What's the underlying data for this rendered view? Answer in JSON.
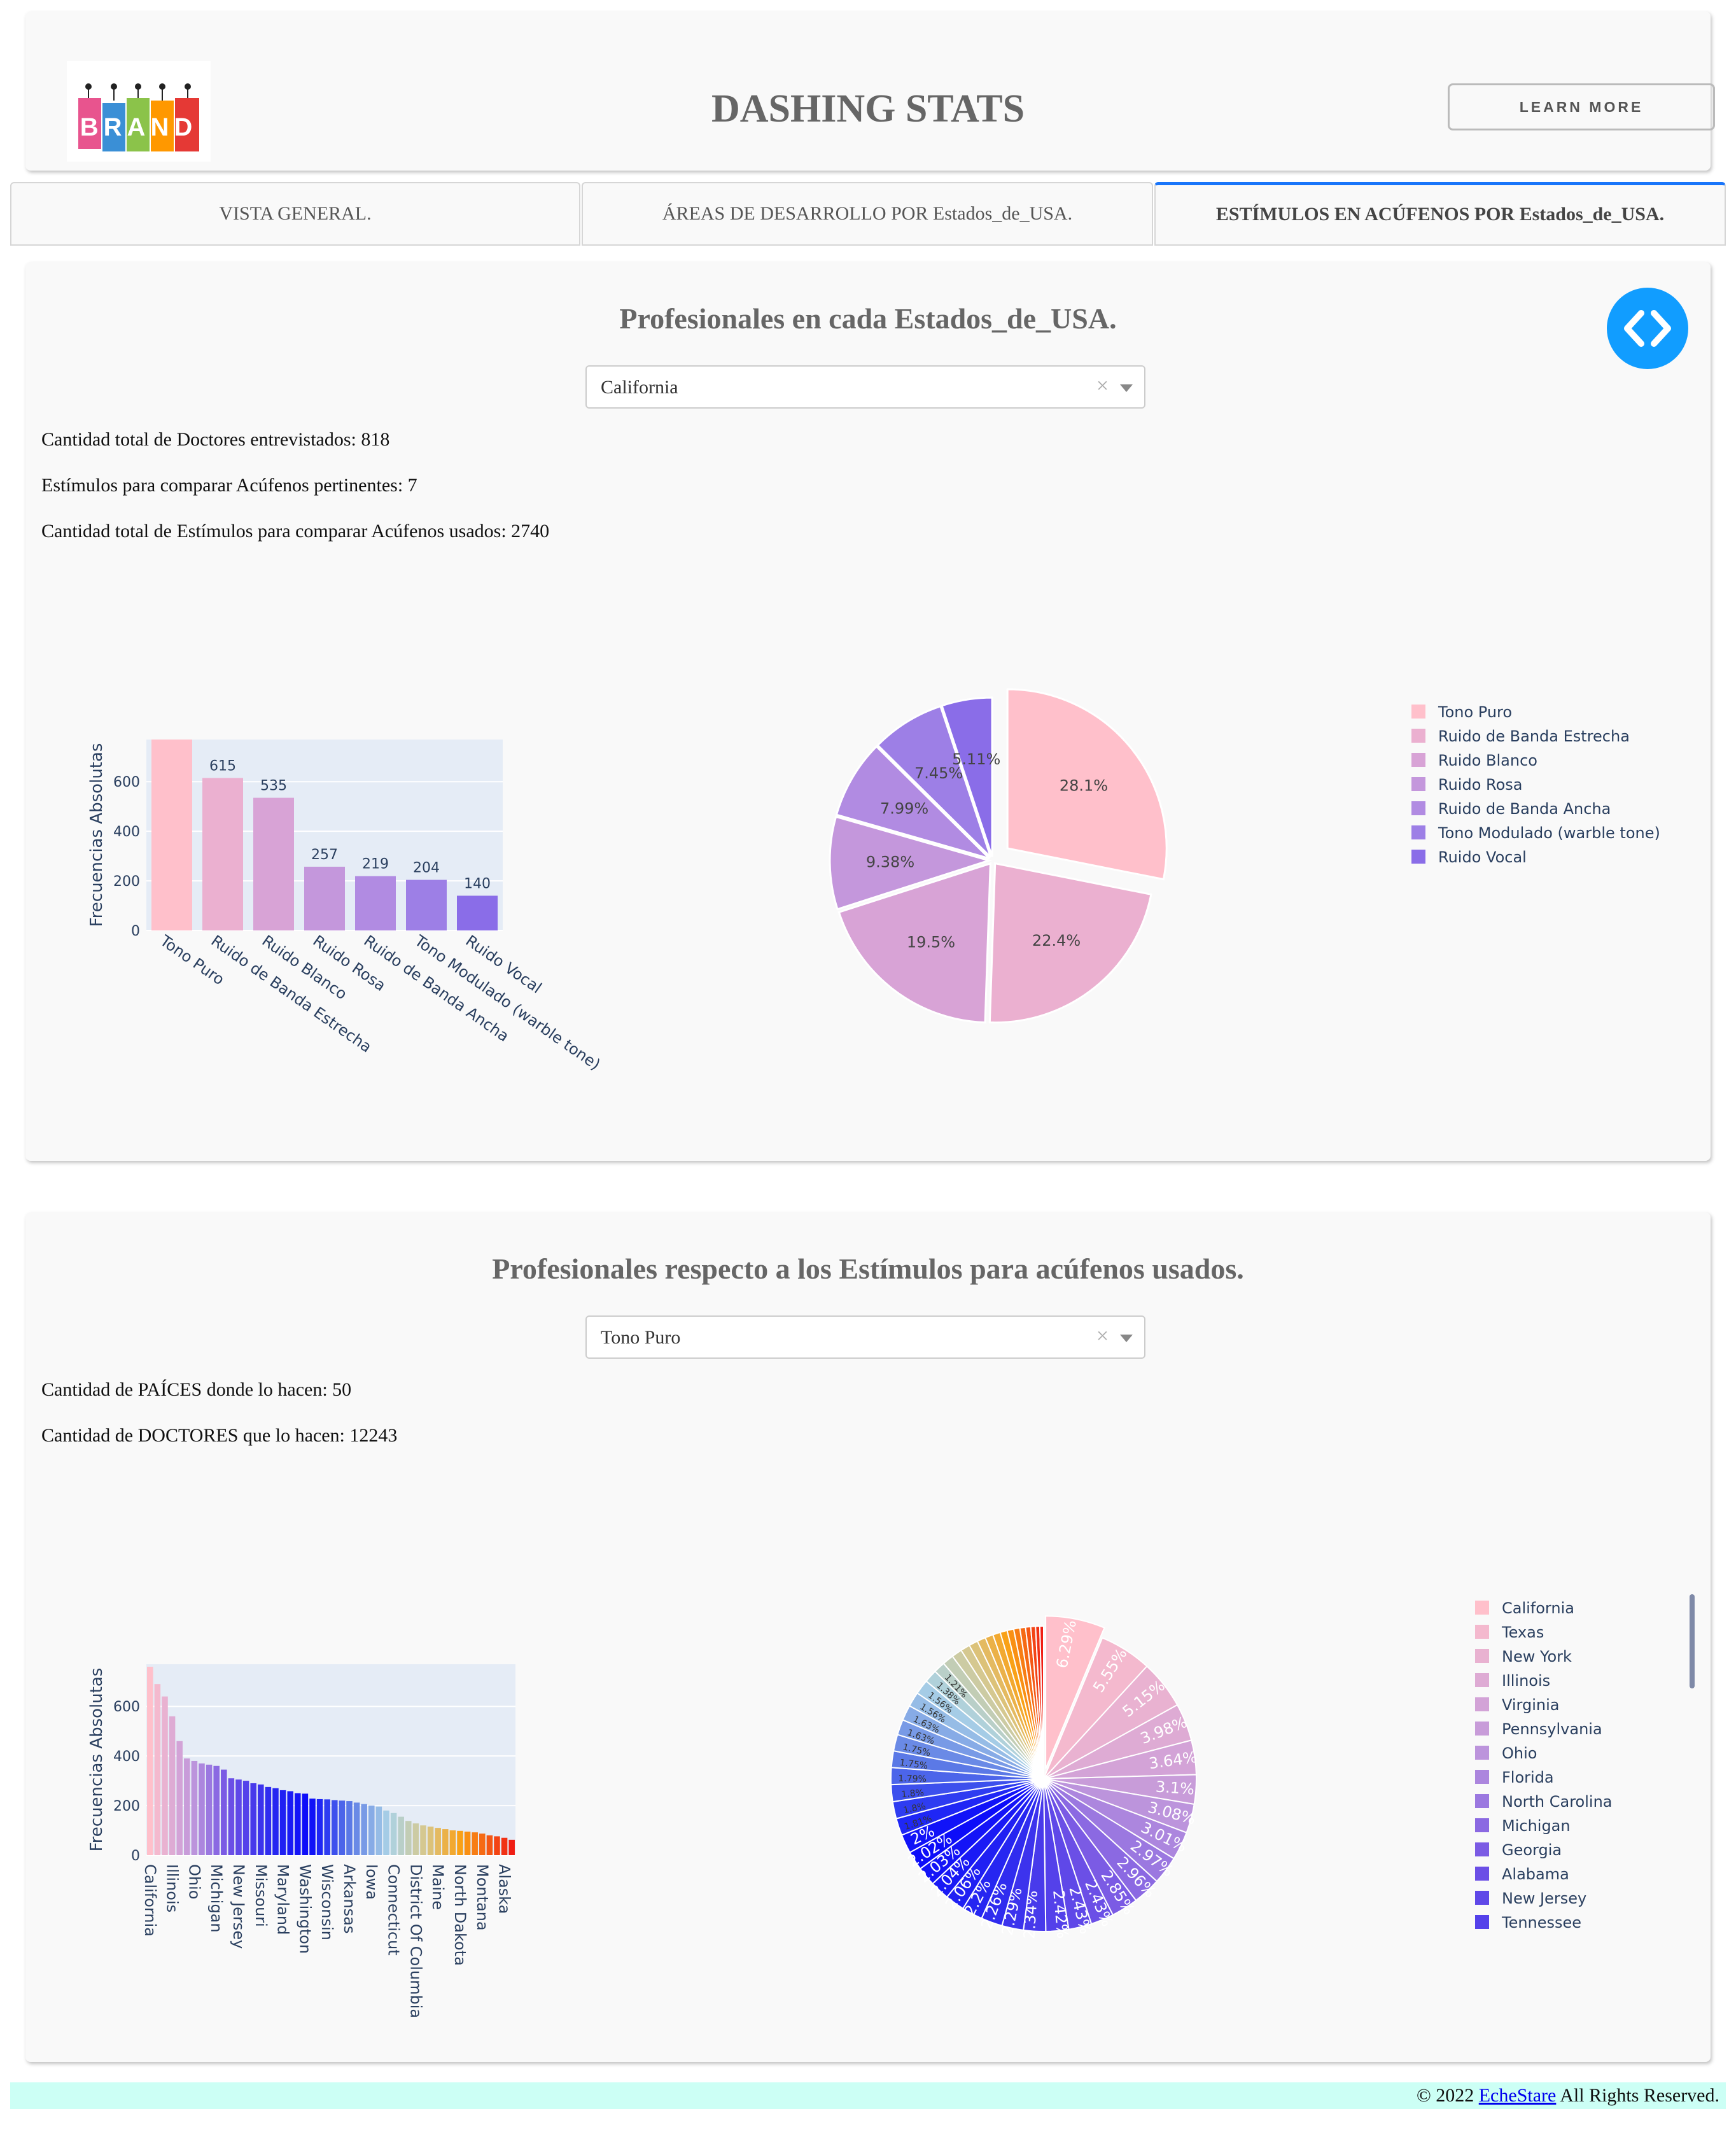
{
  "header": {
    "logo_text": "BRAND",
    "title": "DASHING STATS",
    "learn_more": "LEARN MORE"
  },
  "tabs": [
    {
      "label": "VISTA GENERAL."
    },
    {
      "label": "ÁREAS DE DESARROLLO POR Estados_de_USA."
    },
    {
      "label": "ESTÍMULOS EN ACÚFENOS POR Estados_de_USA.",
      "active": true
    }
  ],
  "section1": {
    "title": "Profesionales en cada Estados_de_USA.",
    "dropdown_value": "California",
    "clear_symbol": "×",
    "stats": [
      "Cantidad total de Doctores entrevistados: 818",
      "Estímulos para comparar Acúfenos pertinentes: 7",
      "Cantidad total de Estímulos para comparar Acúfenos usados: 2740"
    ]
  },
  "section2": {
    "title": "Profesionales respecto a los Estímulos para acúfenos usados.",
    "dropdown_value": "Tono Puro",
    "clear_symbol": "×",
    "stats": [
      "Cantidad de PAÍCES donde lo hacen: 50",
      "Cantidad de DOCTORES que lo hacen: 12243"
    ]
  },
  "footer": {
    "prefix": "© 2022 ",
    "link": "EcheStare",
    "suffix": " All Rights Reserved."
  },
  "colors": {
    "stimuli": [
      "#ffc0cb",
      "#ebb0d0",
      "#d8a3d6",
      "#c497dc",
      "#b18be2",
      "#9d7fe6",
      "#8a6de8"
    ],
    "plot_bg": "#e5ecf6",
    "toggle": "#119dff",
    "footer_bg": "#ccfff5",
    "tab_active": "#1975fa"
  },
  "chart_data": [
    {
      "type": "bar",
      "ylabel": "Frecuencias Absolutas",
      "xlabel": "",
      "ylim": [
        0,
        770
      ],
      "yticks": [
        0,
        200,
        400,
        600
      ],
      "categories": [
        "Tono Puro",
        "Ruido de Banda Estrecha",
        "Ruido Blanco",
        "Ruido Rosa",
        "Ruido de Banda Ancha",
        "Tono Modulado (warble tone)",
        "Ruido Vocal"
      ],
      "values": [
        770,
        615,
        535,
        257,
        219,
        204,
        140
      ],
      "labels": [
        "",
        "615",
        "535",
        "257",
        "219",
        "204",
        "140"
      ]
    },
    {
      "type": "pie",
      "categories": [
        "Tono Puro",
        "Ruido de Banda Estrecha",
        "Ruido Blanco",
        "Ruido Rosa",
        "Ruido de Banda Ancha",
        "Tono Modulado (warble tone)",
        "Ruido Vocal"
      ],
      "values": [
        28.1,
        22.4,
        19.5,
        9.38,
        7.99,
        7.45,
        5.11
      ],
      "labels": [
        "28.1%",
        "22.4%",
        "19.5%",
        "9.38%",
        "7.99%",
        "7.45%",
        "5.11%"
      ],
      "legend_position": "right"
    },
    {
      "type": "bar",
      "ylabel": "Frecuencias Absolutas",
      "xlabel": "",
      "ylim": [
        0,
        770
      ],
      "yticks": [
        0,
        200,
        400,
        600
      ],
      "tick_labels": [
        "California",
        "Illinois",
        "Ohio",
        "Michigan",
        "New Jersey",
        "Missouri",
        "Maryland",
        "Washington",
        "Wisconsin",
        "Arkansas",
        "Iowa",
        "Connecticut",
        "District Of Columbia",
        "Maine",
        "North Dakota",
        "Montana",
        "Alaska"
      ],
      "values": [
        760,
        690,
        640,
        560,
        460,
        390,
        380,
        370,
        365,
        360,
        345,
        310,
        305,
        300,
        290,
        285,
        275,
        270,
        262,
        258,
        250,
        248,
        228,
        226,
        225,
        222,
        220,
        218,
        212,
        206,
        200,
        196,
        180,
        170,
        155,
        138,
        128,
        120,
        115,
        110,
        105,
        100,
        98,
        95,
        92,
        87,
        80,
        76,
        70,
        62
      ]
    },
    {
      "type": "pie",
      "legend": [
        "California",
        "Texas",
        "New York",
        "Illinois",
        "Virginia",
        "Pennsylvania",
        "Ohio",
        "Florida",
        "North Carolina",
        "Michigan",
        "Georgia",
        "Alabama",
        "New Jersey",
        "Tennessee"
      ],
      "labels": [
        "6.29%",
        "5.55%",
        "5.15%",
        "3.98%",
        "3.64%",
        "3.1%",
        "3.08%",
        "3.01%",
        "2.97%",
        "2.96%",
        "2.85%",
        "2.43%",
        "2.43%",
        "2.42%",
        "2.34%",
        "2.29%",
        "2.26%",
        "2.2%",
        "2.06%",
        "2.04%",
        "2.03%",
        "2.02%",
        "2%",
        "1.81%",
        "1.8%",
        "1.8%",
        "1.79%",
        "1.75%",
        "1.75%",
        "1.63%",
        "1.63%",
        "1.56%",
        "1.56%",
        "1.38%",
        "1.21%"
      ],
      "values": [
        6.29,
        5.55,
        5.15,
        3.98,
        3.64,
        3.1,
        3.08,
        3.01,
        2.97,
        2.96,
        2.85,
        2.43,
        2.43,
        2.42,
        2.34,
        2.29,
        2.26,
        2.2,
        2.06,
        2.04,
        2.03,
        2.02,
        2.0,
        1.81,
        1.8,
        1.8,
        1.79,
        1.75,
        1.75,
        1.63,
        1.63,
        1.56,
        1.56,
        1.38,
        1.21,
        1.19,
        1.1,
        1.0,
        0.95,
        0.9,
        0.85,
        0.8,
        0.75,
        0.7,
        0.65,
        0.6,
        0.55,
        0.5,
        0.45,
        0.4
      ],
      "legend_position": "right"
    }
  ]
}
